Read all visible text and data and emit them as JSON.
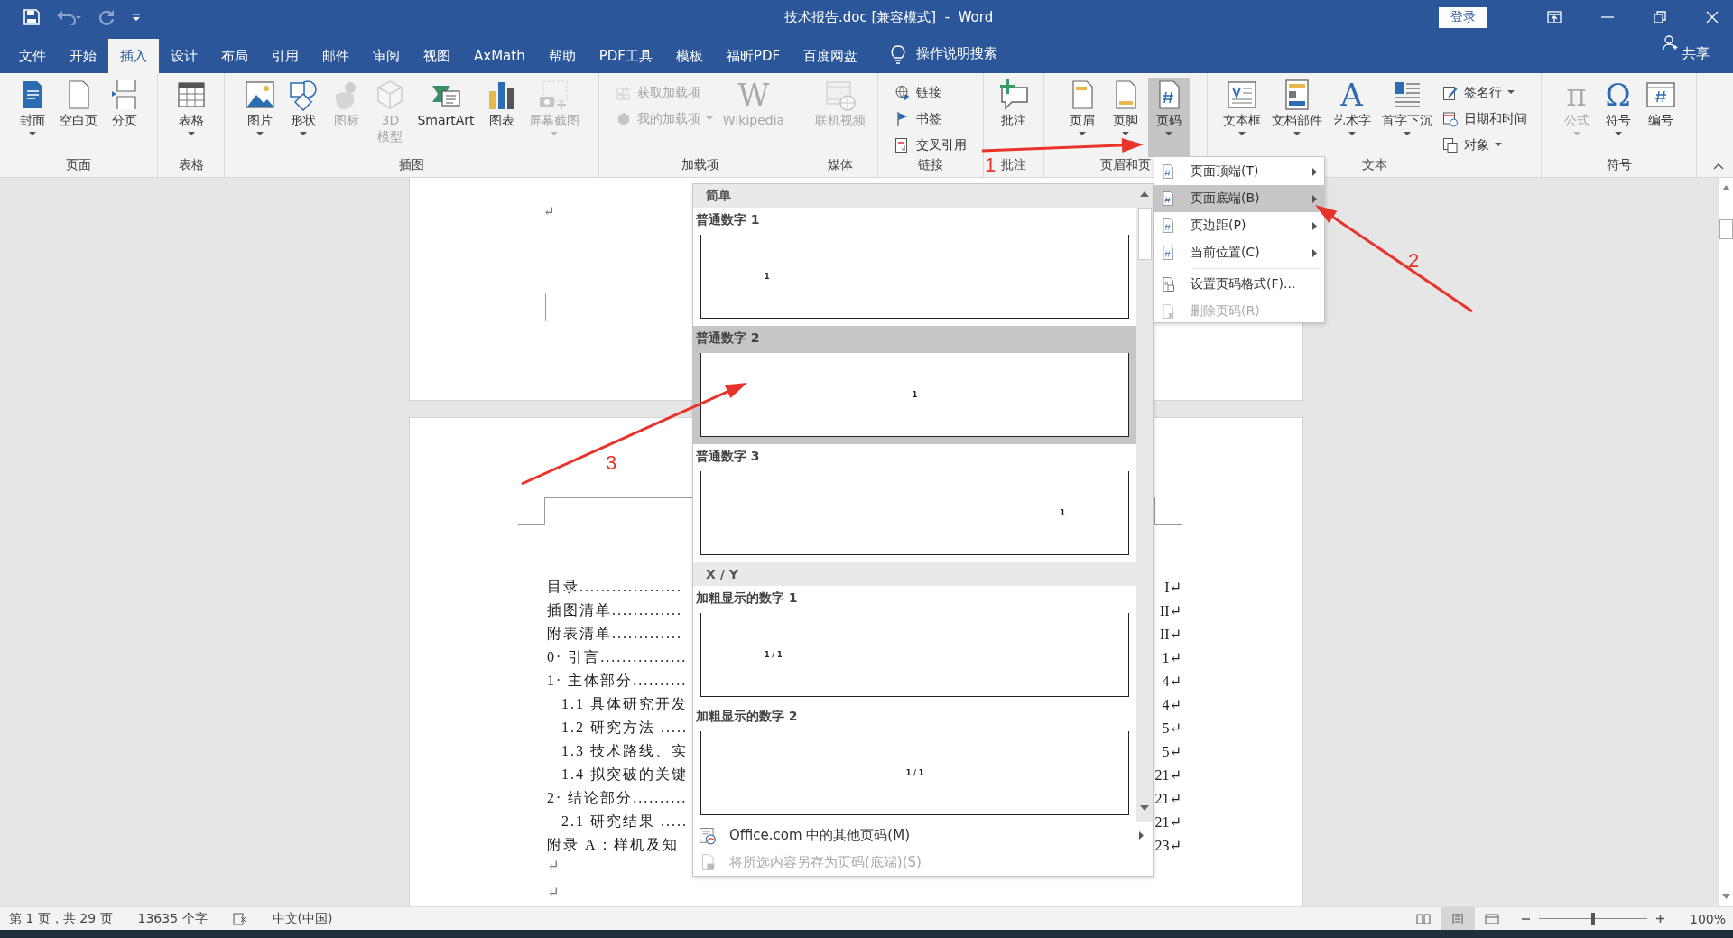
{
  "title_bar": {
    "title": "技术报告.doc [兼容模式]  -  Word",
    "sign_in": "登录"
  },
  "tabs": [
    {
      "label": "文件",
      "selected": false
    },
    {
      "label": "开始",
      "selected": false
    },
    {
      "label": "插入",
      "selected": true
    },
    {
      "label": "设计",
      "selected": false
    },
    {
      "label": "布局",
      "selected": false
    },
    {
      "label": "引用",
      "selected": false
    },
    {
      "label": "邮件",
      "selected": false
    },
    {
      "label": "审阅",
      "selected": false
    },
    {
      "label": "视图",
      "selected": false
    },
    {
      "label": "AxMath",
      "selected": false
    },
    {
      "label": "帮助",
      "selected": false
    },
    {
      "label": "PDF工具",
      "selected": false
    },
    {
      "label": "模板",
      "selected": false
    },
    {
      "label": "福昕PDF",
      "selected": false
    },
    {
      "label": "百度网盘",
      "selected": false
    }
  ],
  "tell_me": "操作说明搜索",
  "share": "共享",
  "ribbon": [
    {
      "label": "页面",
      "items": [
        {
          "label": "封面",
          "kind": "large",
          "dropdown": true,
          "disabled": false,
          "pressed": false
        },
        {
          "label": "空白页",
          "kind": "large",
          "dropdown": false,
          "disabled": false,
          "pressed": false
        },
        {
          "label": "分页",
          "kind": "large",
          "dropdown": false,
          "disabled": false,
          "pressed": false
        }
      ]
    },
    {
      "label": "表格",
      "items": [
        {
          "label": "表格",
          "kind": "large",
          "dropdown": true,
          "disabled": false,
          "pressed": false
        }
      ]
    },
    {
      "label": "插图",
      "items": [
        {
          "label": "图片",
          "kind": "large",
          "dropdown": true,
          "disabled": false,
          "pressed": false
        },
        {
          "label": "形状",
          "kind": "large",
          "dropdown": true,
          "disabled": false,
          "pressed": false
        },
        {
          "label": "图标",
          "kind": "large",
          "dropdown": false,
          "disabled": true,
          "pressed": false,
          "wrap": true
        },
        {
          "label": "3D 模型",
          "kind": "large",
          "dropdown": false,
          "disabled": true,
          "pressed": false,
          "wrap": true
        },
        {
          "label": "SmartArt",
          "kind": "large",
          "dropdown": false,
          "disabled": false,
          "pressed": false
        },
        {
          "label": "图表",
          "kind": "large",
          "dropdown": false,
          "disabled": false,
          "pressed": false
        },
        {
          "label": "屏幕截图",
          "kind": "large",
          "dropdown": true,
          "disabled": true,
          "pressed": false
        }
      ]
    },
    {
      "label": "加载项",
      "items": [
        {
          "label": "获取加载项",
          "kind": "small",
          "dropdown": false,
          "disabled": true,
          "pressed": false
        },
        {
          "label": "我的加载项",
          "kind": "small",
          "dropdown": true,
          "disabled": true,
          "pressed": false
        },
        {
          "label": "Wikipedia",
          "kind": "large",
          "dropdown": false,
          "disabled": true,
          "pressed": false,
          "glyph": "W"
        }
      ]
    },
    {
      "label": "媒体",
      "items": [
        {
          "label": "联机视频",
          "kind": "large",
          "dropdown": false,
          "disabled": true,
          "pressed": false
        }
      ]
    },
    {
      "label": "链接",
      "items": [
        {
          "label": "链接",
          "kind": "small",
          "dropdown": false,
          "disabled": false,
          "pressed": false
        },
        {
          "label": "书签",
          "kind": "small",
          "dropdown": false,
          "disabled": false,
          "pressed": false
        },
        {
          "label": "交叉引用",
          "kind": "small",
          "dropdown": false,
          "disabled": false,
          "pressed": false
        }
      ]
    },
    {
      "label": "批注",
      "items": [
        {
          "label": "批注",
          "kind": "large",
          "dropdown": false,
          "disabled": false,
          "pressed": false
        }
      ]
    },
    {
      "label": "页眉和页",
      "items": [
        {
          "label": "页眉",
          "kind": "large",
          "dropdown": true,
          "disabled": false,
          "pressed": false
        },
        {
          "label": "页脚",
          "kind": "large",
          "dropdown": true,
          "disabled": false,
          "pressed": false
        },
        {
          "label": "页码",
          "kind": "large",
          "dropdown": true,
          "disabled": false,
          "pressed": true
        }
      ]
    },
    {
      "label": "文本",
      "items": [
        {
          "label": "文本框",
          "kind": "large",
          "dropdown": true,
          "disabled": false,
          "pressed": false
        },
        {
          "label": "文档部件",
          "kind": "large",
          "dropdown": true,
          "disabled": false,
          "pressed": false
        },
        {
          "label": "艺术字",
          "kind": "large",
          "dropdown": true,
          "disabled": false,
          "pressed": false,
          "glyph": "A"
        },
        {
          "label": "首字下沉",
          "kind": "large",
          "dropdown": true,
          "disabled": false,
          "pressed": false
        },
        {
          "label": "签名行",
          "kind": "small",
          "dropdown": true,
          "disabled": false,
          "pressed": false
        },
        {
          "label": "日期和时间",
          "kind": "small",
          "dropdown": false,
          "disabled": false,
          "pressed": false
        },
        {
          "label": "对象",
          "kind": "small",
          "dropdown": true,
          "disabled": false,
          "pressed": false
        }
      ]
    },
    {
      "label": "符号",
      "items": [
        {
          "label": "公式",
          "kind": "large",
          "dropdown": true,
          "disabled": true,
          "pressed": false,
          "glyph": "π"
        },
        {
          "label": "符号",
          "kind": "large",
          "dropdown": true,
          "disabled": false,
          "pressed": false,
          "glyph": "Ω"
        },
        {
          "label": "编号",
          "kind": "large",
          "dropdown": false,
          "disabled": false,
          "pressed": false
        }
      ]
    }
  ],
  "document": {
    "page1_mark": "↵",
    "toc": [
      {
        "text": "目录...................",
        "page": "I↵"
      },
      {
        "text": "插图清单.............",
        "page": "II↵"
      },
      {
        "text": "附表清单.............",
        "page": "II↵"
      },
      {
        "text": "0· 引言................",
        "page": "1↵"
      },
      {
        "text": "1· 主体部分..........",
        "page": "4↵",
        "children": [
          {
            "text": "1.1 具体研究开发",
            "page": "4↵"
          },
          {
            "text": "1.2 研究方法 .....",
            "page": "5↵"
          },
          {
            "text": "1.3 技术路线、实",
            "page": "5↵"
          },
          {
            "text": "1.4 拟突破的关键",
            "page": "21↵"
          }
        ]
      },
      {
        "text": "2· 结论部分..........",
        "page": "21↵",
        "children": [
          {
            "text": "2.1 研究结果 .....",
            "page": "21↵"
          }
        ]
      },
      {
        "text": "附录 A：样机及知",
        "page": "23↵"
      }
    ],
    "trailing": [
      "↵",
      "↵"
    ]
  },
  "gallery": {
    "sections": [
      {
        "title": "简单",
        "items": [
          {
            "label": "普通数字 1",
            "preview": "1",
            "kind": "left",
            "selected": false
          },
          {
            "label": "普通数字 2",
            "preview": "1",
            "kind": "center",
            "selected": true
          },
          {
            "label": "普通数字 3",
            "preview": "1",
            "kind": "right",
            "selected": false
          }
        ]
      },
      {
        "title": "X / Y",
        "items": [
          {
            "label": "加粗显示的数字 1",
            "preview": "1 / 1",
            "kind": "left",
            "selected": false
          },
          {
            "label": "加粗显示的数字 2",
            "preview": "1 / 1",
            "kind": "center",
            "selected": false
          }
        ]
      }
    ],
    "footer": [
      {
        "label": "Office.com 中的其他页码(M)",
        "disabled": false,
        "submenu": true
      },
      {
        "label": "将所选内容另存为页码(底端)(S)",
        "disabled": true,
        "submenu": false
      }
    ]
  },
  "submenu": [
    {
      "label": "页面顶端(T)",
      "submenu": true,
      "selected": false,
      "disabled": false
    },
    {
      "label": "页面底端(B)",
      "submenu": true,
      "selected": true,
      "disabled": false
    },
    {
      "label": "页边距(P)",
      "submenu": true,
      "selected": false,
      "disabled": false
    },
    {
      "label": "当前位置(C)",
      "submenu": true,
      "selected": false,
      "disabled": false
    },
    {
      "label": "设置页码格式(F)...",
      "submenu": false,
      "selected": false,
      "disabled": false
    },
    {
      "label": "删除页码(R)",
      "submenu": false,
      "selected": false,
      "disabled": true
    }
  ],
  "annotations": [
    {
      "label": "1"
    },
    {
      "label": "2"
    },
    {
      "label": "3"
    }
  ],
  "status_bar": {
    "page": "第 1 页，共 29 页",
    "words": "13635 个字",
    "language": "中文(中国)",
    "views": [
      {
        "selected": false
      },
      {
        "selected": true
      },
      {
        "selected": false
      }
    ],
    "zoom": {
      "level": 0.5,
      "reading": "100%"
    }
  }
}
